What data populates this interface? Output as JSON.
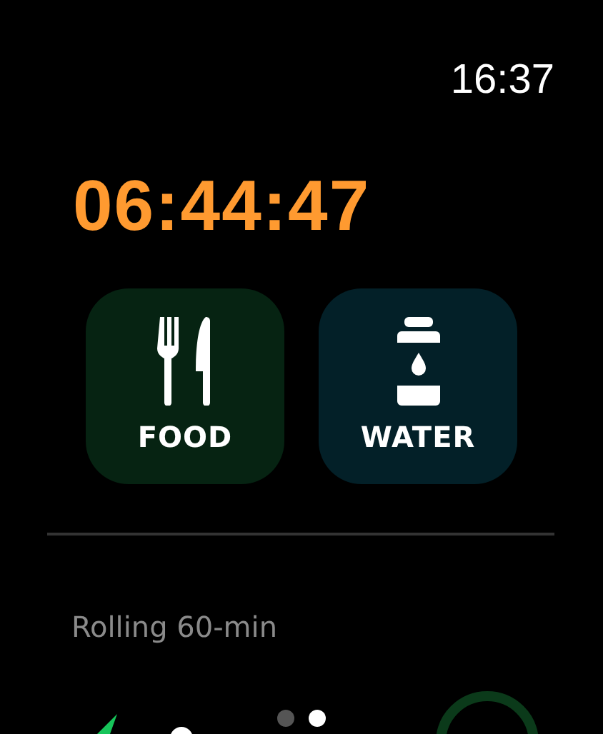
{
  "status_bar": {
    "time": "16:37"
  },
  "timer": {
    "value": "06:44:47"
  },
  "actions": [
    {
      "kind": "food",
      "label": "FOOD"
    },
    {
      "kind": "water",
      "label": "WATER"
    }
  ],
  "section": {
    "title": "Rolling 60-min"
  },
  "pages": [
    {
      "selected": false
    },
    {
      "selected": true
    }
  ]
}
